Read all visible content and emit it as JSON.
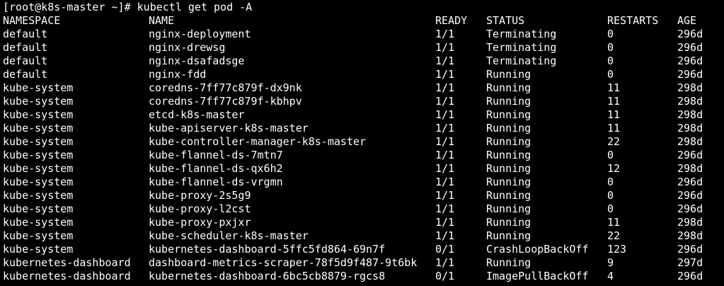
{
  "terminal": {
    "prompt": "[root@k8s-master ~]#",
    "command": "kubectl get pod -A"
  },
  "table": {
    "headers": {
      "namespace": "NAMESPACE",
      "name": "NAME",
      "ready": "READY",
      "status": "STATUS",
      "restarts": "RESTARTS",
      "age": "AGE"
    },
    "rows": [
      {
        "namespace": "default",
        "name": "nginx-deployment",
        "ready": "1/1",
        "status": "Terminating",
        "restarts": "0",
        "age": "296d"
      },
      {
        "namespace": "default",
        "name": "nginx-drewsg",
        "ready": "1/1",
        "status": "Terminating",
        "restarts": "0",
        "age": "296d"
      },
      {
        "namespace": "default",
        "name": "nginx-dsafadsge",
        "ready": "1/1",
        "status": "Terminating",
        "restarts": "0",
        "age": "296d"
      },
      {
        "namespace": "default",
        "name": "nginx-fdd",
        "ready": "1/1",
        "status": "Running",
        "restarts": "0",
        "age": "296d"
      },
      {
        "namespace": "kube-system",
        "name": "coredns-7ff77c879f-dx9nk",
        "ready": "1/1",
        "status": "Running",
        "restarts": "11",
        "age": "298d"
      },
      {
        "namespace": "kube-system",
        "name": "coredns-7ff77c879f-kbhpv",
        "ready": "1/1",
        "status": "Running",
        "restarts": "11",
        "age": "298d"
      },
      {
        "namespace": "kube-system",
        "name": "etcd-k8s-master",
        "ready": "1/1",
        "status": "Running",
        "restarts": "11",
        "age": "298d"
      },
      {
        "namespace": "kube-system",
        "name": "kube-apiserver-k8s-master",
        "ready": "1/1",
        "status": "Running",
        "restarts": "11",
        "age": "298d"
      },
      {
        "namespace": "kube-system",
        "name": "kube-controller-manager-k8s-master",
        "ready": "1/1",
        "status": "Running",
        "restarts": "22",
        "age": "298d"
      },
      {
        "namespace": "kube-system",
        "name": "kube-flannel-ds-7mtn7",
        "ready": "1/1",
        "status": "Running",
        "restarts": "0",
        "age": "296d"
      },
      {
        "namespace": "kube-system",
        "name": "kube-flannel-ds-qx6h2",
        "ready": "1/1",
        "status": "Running",
        "restarts": "12",
        "age": "298d"
      },
      {
        "namespace": "kube-system",
        "name": "kube-flannel-ds-vrgmn",
        "ready": "1/1",
        "status": "Running",
        "restarts": "0",
        "age": "296d"
      },
      {
        "namespace": "kube-system",
        "name": "kube-proxy-2s5g9",
        "ready": "1/1",
        "status": "Running",
        "restarts": "0",
        "age": "296d"
      },
      {
        "namespace": "kube-system",
        "name": "kube-proxy-l2cst",
        "ready": "1/1",
        "status": "Running",
        "restarts": "0",
        "age": "296d"
      },
      {
        "namespace": "kube-system",
        "name": "kube-proxy-pxjxr",
        "ready": "1/1",
        "status": "Running",
        "restarts": "11",
        "age": "298d"
      },
      {
        "namespace": "kube-system",
        "name": "kube-scheduler-k8s-master",
        "ready": "1/1",
        "status": "Running",
        "restarts": "22",
        "age": "298d"
      },
      {
        "namespace": "kube-system",
        "name": "kubernetes-dashboard-5ffc5fd864-69n7f",
        "ready": "0/1",
        "status": "CrashLoopBackOff",
        "restarts": "123",
        "age": "296d"
      },
      {
        "namespace": "kubernetes-dashboard",
        "name": "dashboard-metrics-scraper-78f5d9f487-9t6bk",
        "ready": "1/1",
        "status": "Running",
        "restarts": "9",
        "age": "297d"
      },
      {
        "namespace": "kubernetes-dashboard",
        "name": "kubernetes-dashboard-6bc5cb8879-rgcs8",
        "ready": "0/1",
        "status": "ImagePullBackOff",
        "restarts": "4",
        "age": "296d"
      }
    ]
  },
  "colors": {
    "background": "#000000",
    "foreground": "#ffffff"
  }
}
